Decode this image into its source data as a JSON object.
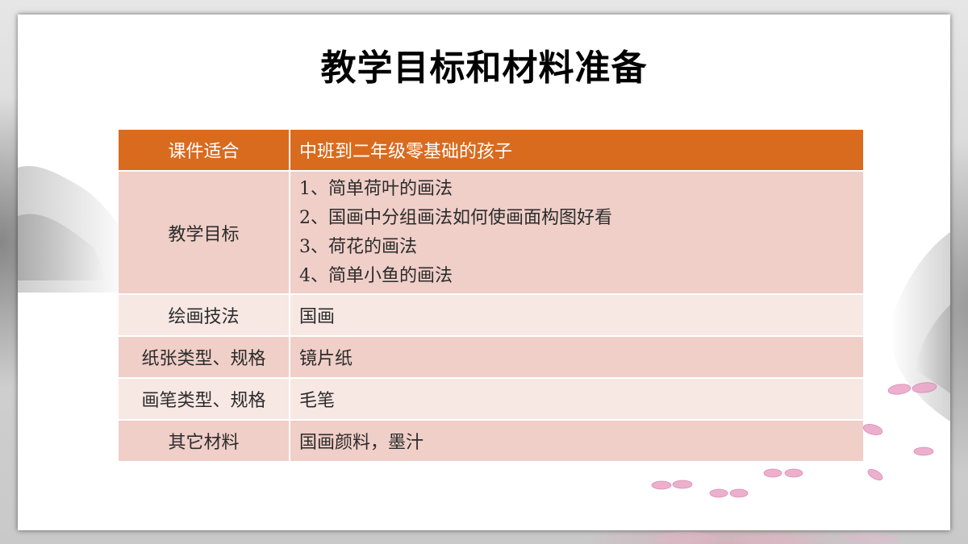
{
  "slide": {
    "title": "教学目标和材料准备"
  },
  "table": {
    "header": {
      "label": "课件适合",
      "value": "中班到二年级零基础的孩子"
    },
    "rows": [
      {
        "label": "教学目标",
        "lines": [
          "1、简单荷叶的画法",
          "2、国画中分组画法如何使画面构图好看",
          "3、荷花的画法",
          "4、简单小鱼的画法"
        ]
      },
      {
        "label": "绘画技法",
        "value": "国画"
      },
      {
        "label": "纸张类型、规格",
        "value": "镜片纸"
      },
      {
        "label": "画笔类型、规格",
        "value": "毛笔"
      },
      {
        "label": "其它材料",
        "value": "国画颜料，墨汁"
      }
    ]
  },
  "colors": {
    "header_bg": "#D96B1F",
    "row_dark_bg": "#EFCFC8",
    "row_light_bg": "#F7E8E4",
    "header_text": "#FFFFFF"
  }
}
